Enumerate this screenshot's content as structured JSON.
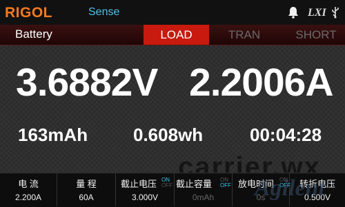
{
  "header": {
    "brand": "RIGOL",
    "sense_label": "Sense",
    "lxi_label": "LXI"
  },
  "icons": {
    "bell": "bell-icon",
    "usb": "usb-icon"
  },
  "mode": {
    "title": "Battery"
  },
  "tabs": [
    {
      "label": "LOAD",
      "active": true
    },
    {
      "label": "TRAN",
      "active": false
    },
    {
      "label": "SHORT",
      "active": false
    }
  ],
  "readings": {
    "voltage": "3.6882V",
    "current": "2.2006A",
    "capacity": "163mAh",
    "energy": "0.608wh",
    "elapsed": "00:04:28"
  },
  "params": [
    {
      "label": "电 流",
      "value": "2.200A"
    },
    {
      "label": "量 程",
      "value": "60A"
    },
    {
      "label": "截止电压",
      "value": "3.000V",
      "toggle_on": "ON",
      "toggle_off": "OFF",
      "state": "ON"
    },
    {
      "label": "截止容量",
      "value": "0mAh",
      "toggle_on": "ON",
      "toggle_off": "OFF",
      "state": "OFF"
    },
    {
      "label": "放电时间",
      "value": "0s",
      "toggle_on": "ON",
      "toggle_off": "OFF",
      "state": "OFF"
    },
    {
      "label": "转折电压",
      "value": "0.500V"
    }
  ],
  "watermarks": {
    "carrier": "carrier.wx",
    "agilent": "Agilent"
  },
  "colors": {
    "brand": "#f47a20",
    "sense": "#4fc3e8",
    "active_tab": "#c81a0e",
    "toggle_active": "#39c8e8"
  }
}
